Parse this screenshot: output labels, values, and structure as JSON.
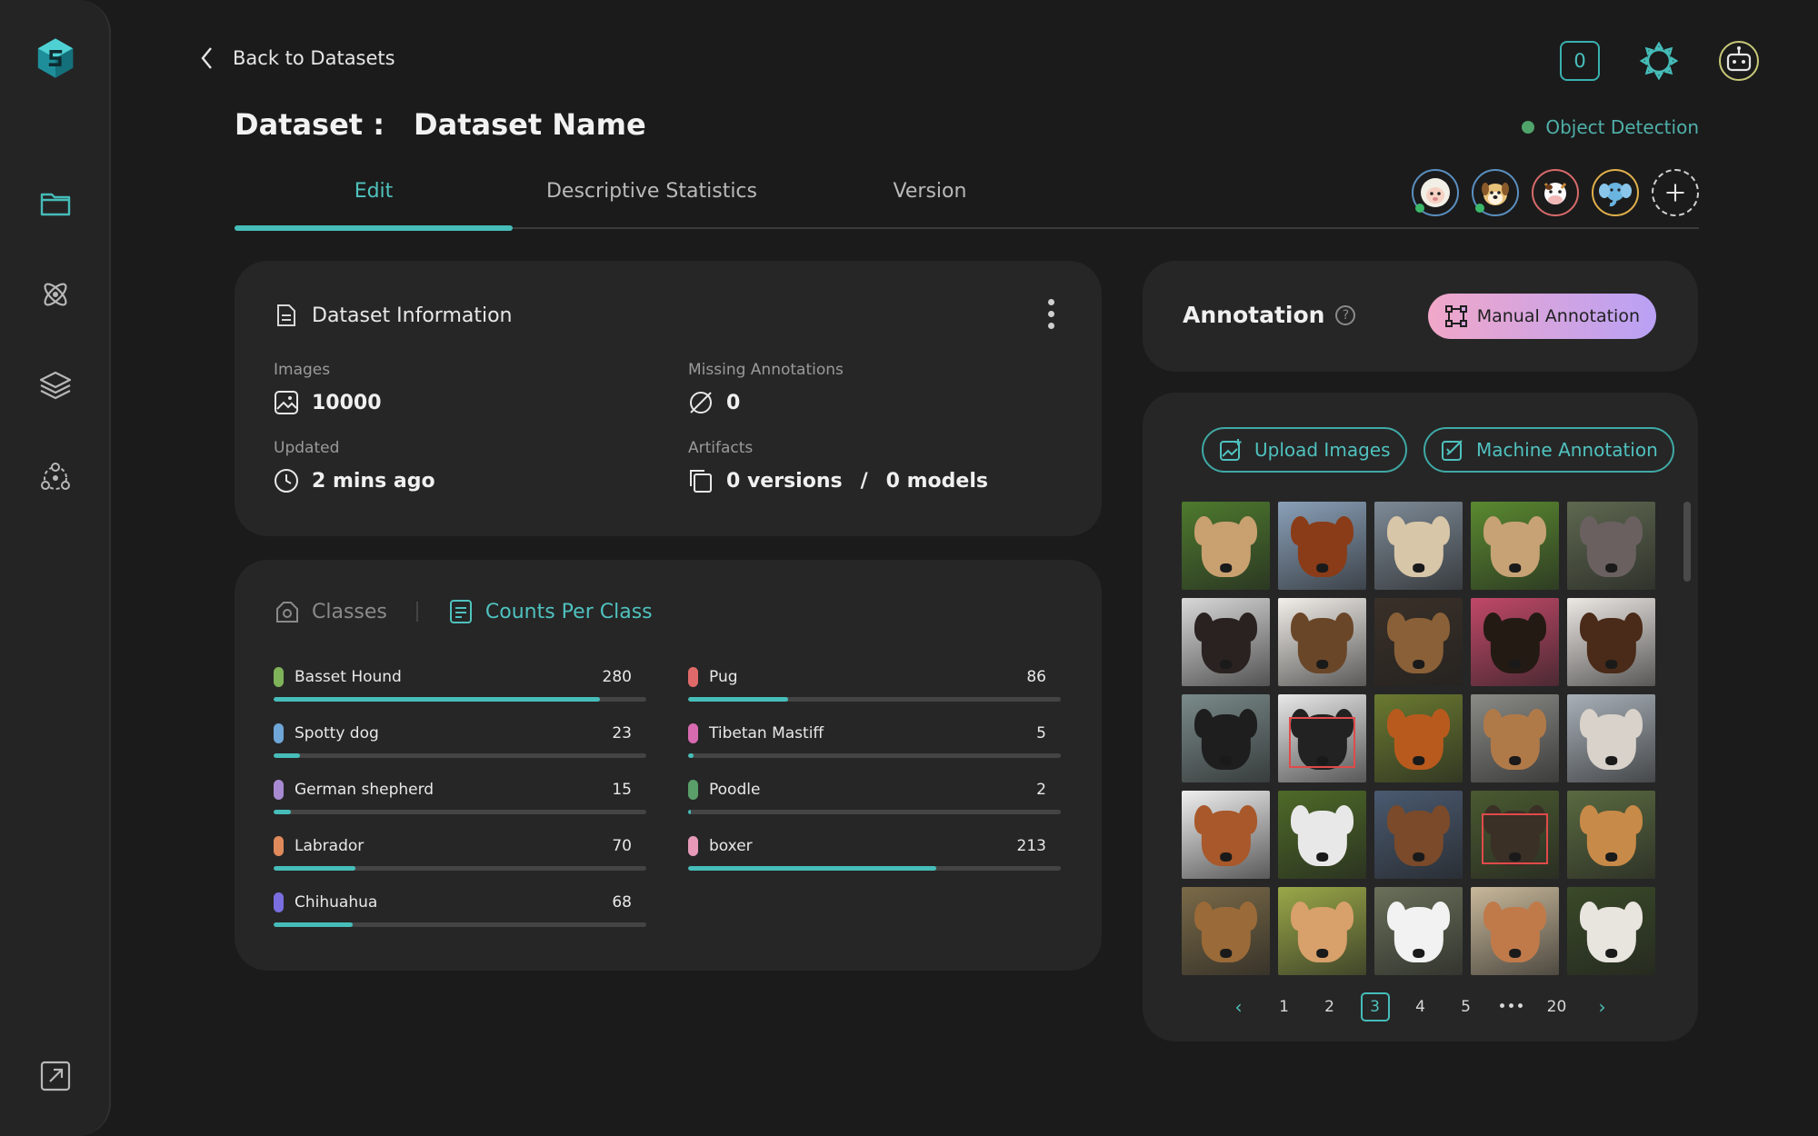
{
  "nav": {
    "back_label": "Back to Datasets",
    "sidebar": [
      {
        "name": "logo-icon"
      },
      {
        "name": "folder-icon"
      },
      {
        "name": "atom-icon"
      },
      {
        "name": "layers-icon"
      },
      {
        "name": "team-icon"
      },
      {
        "name": "external-link-icon"
      }
    ]
  },
  "header": {
    "title_prefix": "Dataset :",
    "dataset_name": "Dataset Name",
    "notification_count": "0",
    "task_type": "Object Detection"
  },
  "tabs": [
    {
      "label": "Edit",
      "active": true
    },
    {
      "label": "Descriptive Statistics",
      "active": false
    },
    {
      "label": "Version",
      "active": false
    }
  ],
  "collaborators": [
    "avatar-sheep",
    "avatar-dog",
    "avatar-cow",
    "avatar-elephant"
  ],
  "info": {
    "title": "Dataset Information",
    "images_label": "Images",
    "images_value": "10000",
    "missing_label": "Missing Annotations",
    "missing_value": "0",
    "updated_label": "Updated",
    "updated_value": "2 mins ago",
    "artifacts_label": "Artifacts",
    "versions_value": "0 versions",
    "artifacts_sep": "/",
    "models_value": "0 models"
  },
  "classes": {
    "tab_classes": "Classes",
    "tab_counts": "Counts Per Class",
    "max": 320,
    "items": [
      {
        "name": "Basset Hound",
        "count": 280,
        "color": "#7fb35a"
      },
      {
        "name": "Spotty dog",
        "count": 23,
        "color": "#6ea6d8"
      },
      {
        "name": "German shepherd",
        "count": 15,
        "color": "#a78ad1"
      },
      {
        "name": "Labrador",
        "count": 70,
        "color": "#e0895a"
      },
      {
        "name": "Chihuahua",
        "count": 68,
        "color": "#7a6ee0"
      },
      {
        "name": "Pug",
        "count": 86,
        "color": "#e06a6a"
      },
      {
        "name": "Tibetan Mastiff",
        "count": 5,
        "color": "#d86ab0"
      },
      {
        "name": "Poodle",
        "count": 2,
        "color": "#5a9e6a"
      },
      {
        "name": "boxer",
        "count": 213,
        "color": "#e69ab8"
      }
    ]
  },
  "annotation": {
    "title": "Annotation",
    "help": "?",
    "manual_label": "Manual Annotation",
    "upload_label": "Upload Images",
    "machine_label": "Machine Annotation"
  },
  "gallery": {
    "thumbs": [
      {
        "bg": "#4e7a2e",
        "dog": "#c9a070",
        "bbox": false
      },
      {
        "bg": "#8aa0b8",
        "dog": "#8a3c18",
        "bbox": false
      },
      {
        "bg": "#7d8a96",
        "dog": "#d8c6a8",
        "bbox": false
      },
      {
        "bg": "#5a8a30",
        "dog": "#c7a274",
        "bbox": false
      },
      {
        "bg": "#5e6850",
        "dog": "#6a6060",
        "bbox": false
      },
      {
        "bg": "#d8d8d8",
        "dog": "#2a2220",
        "bbox": false
      },
      {
        "bg": "#f2efea",
        "dog": "#6a4628",
        "bbox": false
      },
      {
        "bg": "#3a3028",
        "dog": "#8a6038",
        "bbox": false
      },
      {
        "bg": "#c04868",
        "dog": "#241a14",
        "bbox": false
      },
      {
        "bg": "#ece8e4",
        "dog": "#4a2a18",
        "bbox": false
      },
      {
        "bg": "#7a8a8a",
        "dog": "#1e1e1e",
        "bbox": false
      },
      {
        "bg": "#e8e8e8",
        "dog": "#222222",
        "bbox": true
      },
      {
        "bg": "#6a7a30",
        "dog": "#b85a1e",
        "bbox": false
      },
      {
        "bg": "#8a8a86",
        "dog": "#b07a48",
        "bbox": false
      },
      {
        "bg": "#a8b0b8",
        "dog": "#d8d2ca",
        "bbox": false
      },
      {
        "bg": "#efefef",
        "dog": "#a8582a",
        "bbox": false
      },
      {
        "bg": "#4e6a28",
        "dog": "#e8e8e8",
        "bbox": false
      },
      {
        "bg": "#4a5a70",
        "dog": "#7a4a2a",
        "bbox": false
      },
      {
        "bg": "#4a5a30",
        "dog": "#3a3026",
        "bbox": true
      },
      {
        "bg": "#5a6a40",
        "dog": "#c88a48",
        "bbox": false
      },
      {
        "bg": "#7a6a48",
        "dog": "#9a6a38",
        "bbox": false
      },
      {
        "bg": "#9aa848",
        "dog": "#d8a06a",
        "bbox": false
      },
      {
        "bg": "#6a705a",
        "dog": "#f2f2f2",
        "bbox": false
      },
      {
        "bg": "#c8b89a",
        "dog": "#c07a4a",
        "bbox": false
      },
      {
        "bg": "#3a4a28",
        "dog": "#e8e4de",
        "bbox": false
      }
    ]
  },
  "pagination": {
    "prev": "‹",
    "pages": [
      "1",
      "2",
      "3",
      "4",
      "5"
    ],
    "active": "3",
    "ellipsis": "•••",
    "last": "20",
    "next": "›"
  }
}
